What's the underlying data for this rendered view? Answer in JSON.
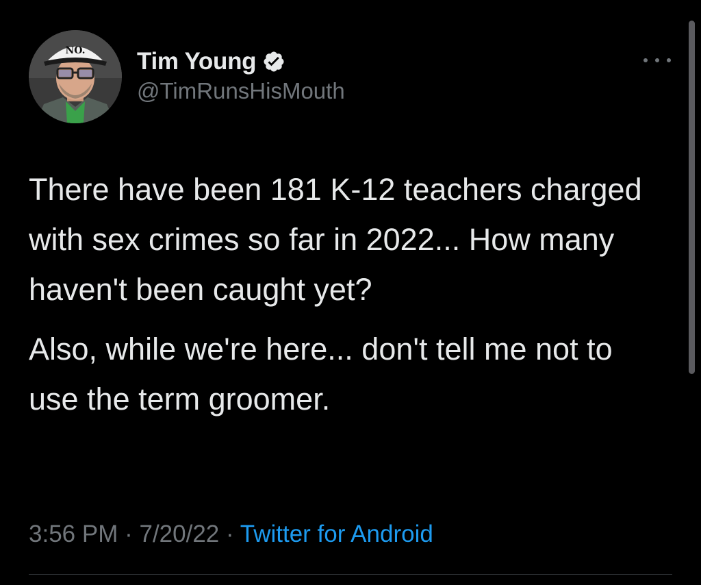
{
  "author": {
    "display_name": "Tim Young",
    "handle": "@TimRunsHisMouth",
    "verified": true,
    "avatar_hat_text": "NO."
  },
  "tweet": {
    "paragraphs": [
      "There have been 181 K-12 teachers charged with sex crimes so far in 2022... How many haven't been caught yet?",
      "Also, while we're here... don't tell me not to use the term groomer."
    ],
    "time": "3:56 PM",
    "date": "7/20/22",
    "separator": "·",
    "source": "Twitter for Android"
  },
  "icons": {
    "verified": "verified-badge-icon",
    "more": "more-options-icon"
  },
  "colors": {
    "background": "#000000",
    "text_primary": "#e7e9ea",
    "text_secondary": "#71767b",
    "link": "#1d9bf0",
    "divider": "#2f3336"
  }
}
